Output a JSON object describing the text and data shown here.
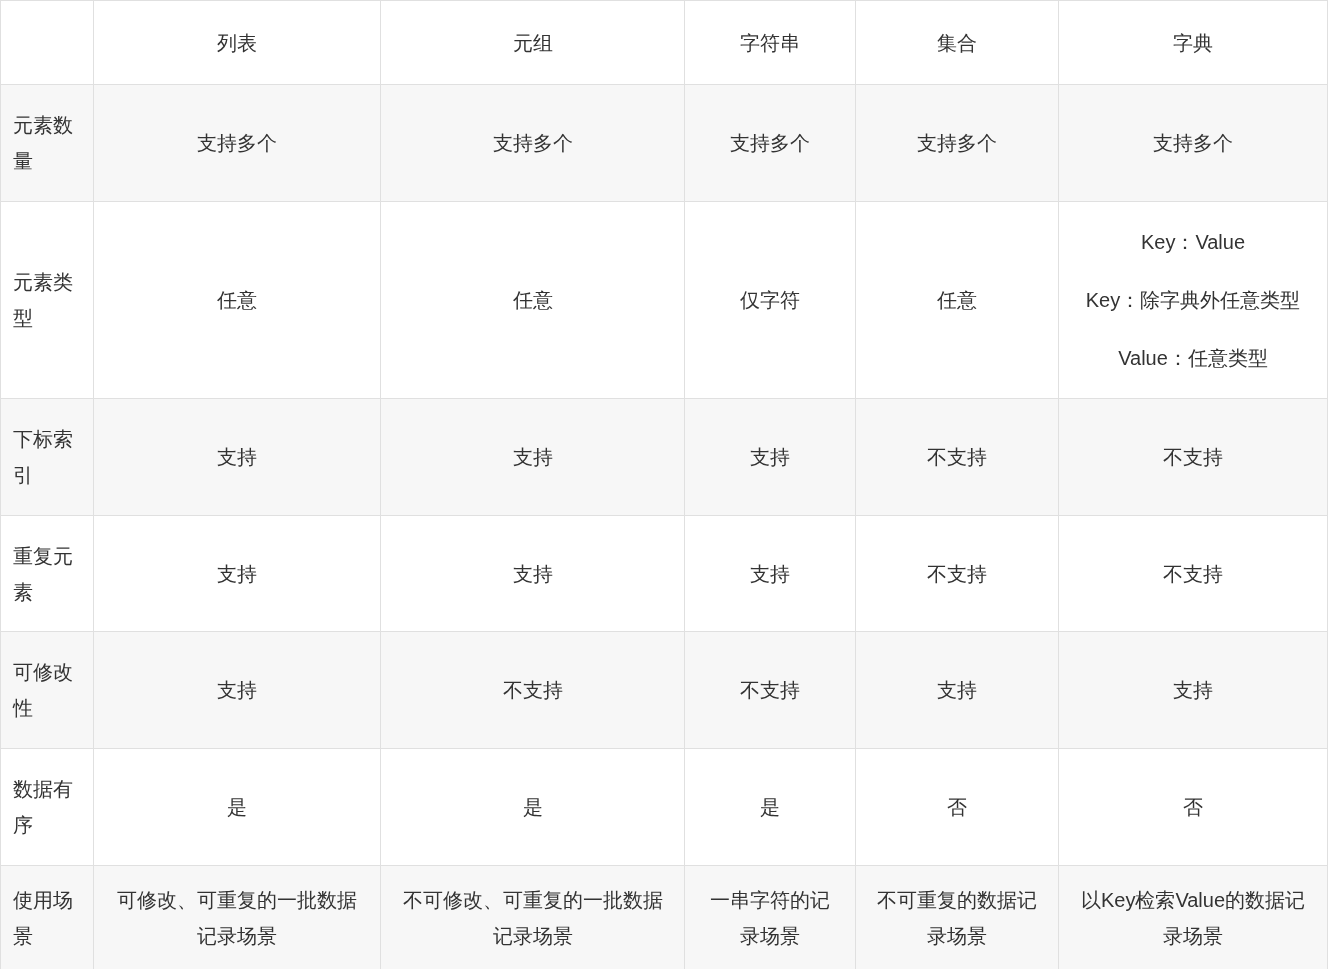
{
  "table": {
    "columns": [
      "列表",
      "元组",
      "字符串",
      "集合",
      "字典"
    ],
    "rows": [
      {
        "label": "元素数量",
        "cells": [
          [
            "支持多个"
          ],
          [
            "支持多个"
          ],
          [
            "支持多个"
          ],
          [
            "支持多个"
          ],
          [
            "支持多个"
          ]
        ]
      },
      {
        "label": "元素类型",
        "cells": [
          [
            "任意"
          ],
          [
            "任意"
          ],
          [
            "仅字符"
          ],
          [
            "任意"
          ],
          [
            "Key：Value",
            "Key：除字典外任意类型",
            "Value：任意类型"
          ]
        ]
      },
      {
        "label": "下标索引",
        "cells": [
          [
            "支持"
          ],
          [
            "支持"
          ],
          [
            "支持"
          ],
          [
            "不支持"
          ],
          [
            "不支持"
          ]
        ]
      },
      {
        "label": "重复元素",
        "cells": [
          [
            "支持"
          ],
          [
            "支持"
          ],
          [
            "支持"
          ],
          [
            "不支持"
          ],
          [
            "不支持"
          ]
        ]
      },
      {
        "label": "可修改性",
        "cells": [
          [
            "支持"
          ],
          [
            "不支持"
          ],
          [
            "不支持"
          ],
          [
            "支持"
          ],
          [
            "支持"
          ]
        ]
      },
      {
        "label": "数据有序",
        "cells": [
          [
            "是"
          ],
          [
            "是"
          ],
          [
            "是"
          ],
          [
            "否"
          ],
          [
            "否"
          ]
        ]
      },
      {
        "label": "使用场景",
        "cells": [
          [
            "可修改、可重复的一批数据记录场景"
          ],
          [
            "不可修改、可重复的一批数据记录场景"
          ],
          [
            "一串字符的记录场景"
          ],
          [
            "不可重复的数据记录场景"
          ],
          [
            "以Key检索Value的数据记录场景"
          ]
        ]
      }
    ]
  }
}
